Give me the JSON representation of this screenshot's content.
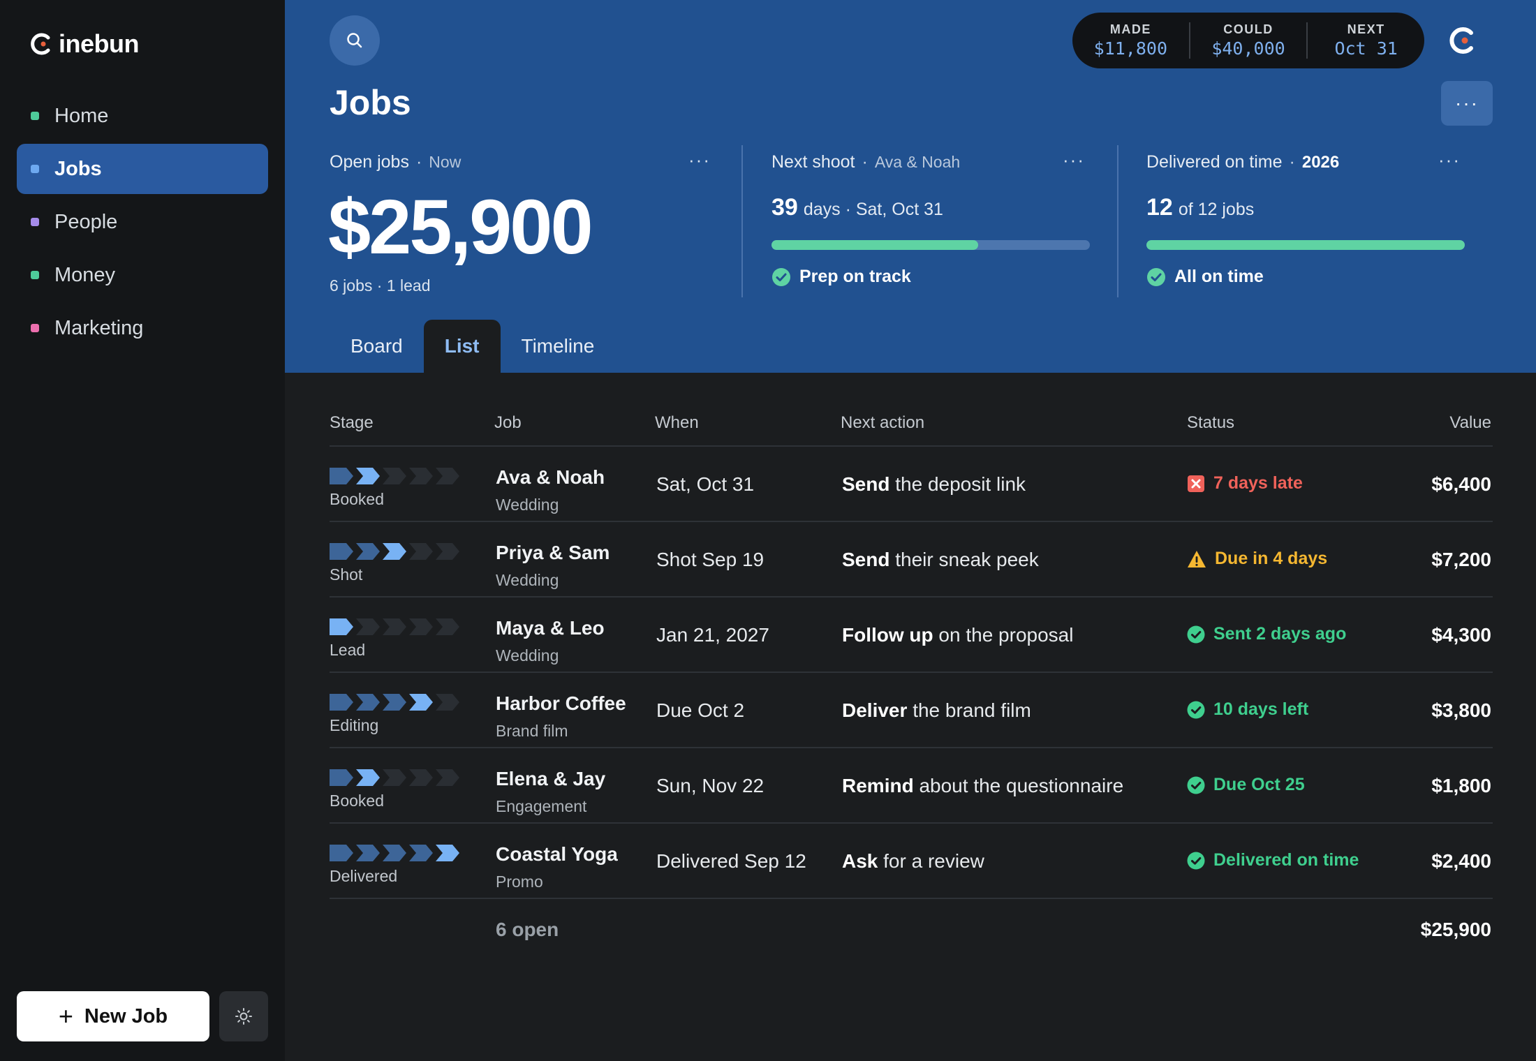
{
  "brand": {
    "name": "inebun",
    "accent": "#e8603c"
  },
  "nav": {
    "items": [
      {
        "label": "Home",
        "color": "#4ecb9a"
      },
      {
        "label": "Jobs",
        "color": "#6ea9f0"
      },
      {
        "label": "People",
        "color": "#a58bea"
      },
      {
        "label": "Money",
        "color": "#4ecb9a"
      },
      {
        "label": "Marketing",
        "color": "#ec6fae"
      }
    ],
    "active": "Jobs"
  },
  "new_job_label": "New Job",
  "topbar": {
    "stats": [
      {
        "label": "MADE",
        "value": "$11,800"
      },
      {
        "label": "COULD",
        "value": "$40,000"
      },
      {
        "label": "NEXT",
        "value": "Oct 31"
      }
    ]
  },
  "page_title": "Jobs",
  "cards": {
    "open_jobs": {
      "title": "Open jobs",
      "sub": "Now",
      "amount": "$25,900",
      "detail": "6 jobs · 1 lead"
    },
    "next_shoot": {
      "title": "Next shoot",
      "sub": "Ava & Noah",
      "number": "39",
      "text": "days · Sat, Oct 31",
      "progress": 0.65,
      "status": "Prep on track"
    },
    "delivered": {
      "title": "Delivered on time",
      "sub": "2026",
      "number": "12",
      "text": "of 12 jobs",
      "progress": 1.0,
      "status": "All on time"
    }
  },
  "tabs": [
    "Board",
    "List",
    "Timeline"
  ],
  "active_tab": "List",
  "table": {
    "headers": {
      "stage": "Stage",
      "job": "Job",
      "when": "When",
      "action": "Next action",
      "status": "Status",
      "value": "Value"
    },
    "rows": [
      {
        "stage": "Booked",
        "stage_index": 2,
        "name": "Ava & Noah",
        "type": "Wedding",
        "when": "Sat, Oct 31",
        "verb": "Send",
        "rest": "the deposit link",
        "status": "7 days late",
        "status_kind": "late",
        "value": "$6,400"
      },
      {
        "stage": "Shot",
        "stage_index": 3,
        "name": "Priya & Sam",
        "type": "Wedding",
        "when": "Shot Sep 19",
        "verb": "Send",
        "rest": "their sneak peek",
        "status": "Due in 4 days",
        "status_kind": "warn",
        "value": "$7,200"
      },
      {
        "stage": "Lead",
        "stage_index": 1,
        "name": "Maya & Leo",
        "type": "Wedding",
        "when": "Jan 21, 2027",
        "verb": "Follow up",
        "rest": "on the proposal",
        "status": "Sent 2 days ago",
        "status_kind": "ok",
        "value": "$4,300"
      },
      {
        "stage": "Editing",
        "stage_index": 4,
        "name": "Harbor Coffee",
        "type": "Brand film",
        "when": "Due Oct 2",
        "verb": "Deliver",
        "rest": "the brand film",
        "status": "10 days left",
        "status_kind": "ok",
        "value": "$3,800"
      },
      {
        "stage": "Booked",
        "stage_index": 2,
        "name": "Elena & Jay",
        "type": "Engagement",
        "when": "Sun, Nov 22",
        "verb": "Remind",
        "rest": "about the questionnaire",
        "status": "Due Oct 25",
        "status_kind": "ok",
        "value": "$1,800"
      },
      {
        "stage": "Delivered",
        "stage_index": 5,
        "name": "Coastal Yoga",
        "type": "Promo",
        "when": "Delivered Sep 12",
        "verb": "Ask",
        "rest": "for a review",
        "status": "Delivered on time",
        "status_kind": "ok",
        "value": "$2,400"
      }
    ],
    "footer": {
      "count": "6 open",
      "total": "$25,900"
    }
  },
  "colors": {
    "late": "#f0625a",
    "warn": "#f5b731",
    "ok": "#3fcf8e",
    "chev_done": "#3d6598",
    "chev_current": "#78b2f4",
    "chev_todo": "#2a2e33"
  }
}
